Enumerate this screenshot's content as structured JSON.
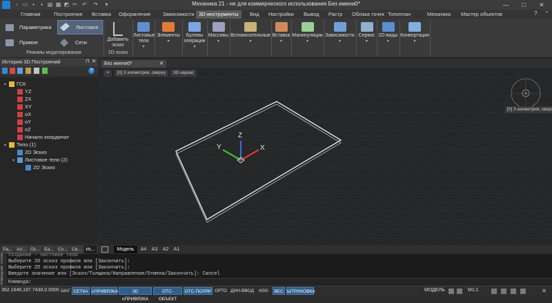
{
  "app": {
    "title": "Механика 21 - не для коммерческого использования Без имени0*"
  },
  "window_controls": {
    "minimize": "—",
    "maximize": "□",
    "close": "✕"
  },
  "menu": {
    "tabs": [
      "Главная",
      "Построение",
      "Вставка",
      "Оформление",
      "Зависимости",
      "3D-инструменты",
      "Вид",
      "Настройки",
      "Вывод",
      "Растр",
      "Облака точек",
      "Топоплан",
      "Механика",
      "Мастер объектов"
    ],
    "active": "3D-инструменты"
  },
  "ribbon": {
    "modes": {
      "param": "Параметрика",
      "direct": "Прямое",
      "sheet": "Листовое",
      "mesh": "Сети",
      "group_label": "Режимы моделирования"
    },
    "add_sketch": "Добавить эскиз",
    "sketch_group": "2D-эскиз",
    "buttons": [
      {
        "label": "Листовые тела",
        "id": "sheet-bodies"
      },
      {
        "label": "Элементы",
        "id": "elements"
      },
      {
        "label": "Булевы операции",
        "id": "boolean"
      },
      {
        "label": "Массивы",
        "id": "arrays"
      },
      {
        "label": "Вспомогательные",
        "id": "auxiliary"
      },
      {
        "label": "Вставка",
        "id": "insert"
      },
      {
        "label": "Манипуляции",
        "id": "manipulations"
      },
      {
        "label": "Зависимости",
        "id": "dependencies"
      },
      {
        "label": "Сервис",
        "id": "service"
      },
      {
        "label": "2D-виды",
        "id": "views2d"
      },
      {
        "label": "Конвертация",
        "id": "conversion"
      }
    ]
  },
  "left_panel": {
    "title": "История 3D Построений",
    "tree": [
      {
        "label": "ГСК",
        "level": 0,
        "icon": "folder",
        "twisty": "▾"
      },
      {
        "label": "YZ",
        "level": 1,
        "icon": "plane"
      },
      {
        "label": "ZX",
        "level": 1,
        "icon": "plane"
      },
      {
        "label": "XY",
        "level": 1,
        "icon": "plane"
      },
      {
        "label": "oX",
        "level": 1,
        "icon": "axis"
      },
      {
        "label": "oY",
        "level": 1,
        "icon": "axis"
      },
      {
        "label": "oZ",
        "level": 1,
        "icon": "axis"
      },
      {
        "label": "Начало координат",
        "level": 1,
        "icon": "origin"
      },
      {
        "label": "Тело (1)",
        "level": 0,
        "icon": "body",
        "twisty": "▾"
      },
      {
        "label": "2D Эскиз",
        "level": 1,
        "icon": "sketch"
      },
      {
        "label": "Листовое тело (2)",
        "level": 1,
        "icon": "sheet",
        "twisty": "▾"
      },
      {
        "label": "2D Эскиз",
        "level": 2,
        "icon": "sketch"
      }
    ],
    "tabs": [
      "Ра...",
      "Ал...",
      "Ос...",
      "Ба...",
      "Сп...",
      "Св...",
      "Ис..."
    ],
    "active_tab": "Ис..."
  },
  "document": {
    "tab": "Без имени0*",
    "view_buttons": [
      "+",
      "[0] 3 изометрия, сверху",
      "3D каркас"
    ],
    "viewcube_label": "[0] 3 изометрия, сверху",
    "axes": {
      "x": "X",
      "y": "Y",
      "z": "Z"
    },
    "layout_tabs": [
      "Модель",
      "A4",
      "A3",
      "A2",
      "A1"
    ],
    "active_layout": "Модель"
  },
  "command": {
    "side_label": "Командная строка",
    "history": [
      "Создание - листовое тело",
      "Выберите 2D эскиз профиля или [Закончить]:",
      "Выберите 2D эскиз профиля или [Закончить]:",
      "Введите значение или [Эскиз/Толщина/Направление/Отмена/Закончить]: Cancel"
    ],
    "prompt": "Команда:"
  },
  "status": {
    "coords": "362.1646,197.7438,0.0000",
    "toggles": [
      {
        "label": "ШАГ",
        "on": false
      },
      {
        "label": "СЕТКА",
        "on": true
      },
      {
        "label": "оПРИВЯЗКА",
        "on": true
      },
      {
        "label": "3D оПРИВЯЗКА",
        "on": true
      },
      {
        "label": "ОТС-ОБЪЕКТ",
        "on": true
      },
      {
        "label": "ОТС-ПОЛЯР",
        "on": true
      },
      {
        "label": "ОРТО",
        "on": false
      },
      {
        "label": "ДИН-ВВОД",
        "on": false
      },
      {
        "label": "ИЗО",
        "on": false
      },
      {
        "label": "ВЕС",
        "on": true
      },
      {
        "label": "ШТРИХОВКА",
        "on": true
      }
    ],
    "model": "МОДЕЛЬ",
    "scale": "M1:1"
  },
  "colors": {
    "accent": "#2f5e8a",
    "axis_x": "#d23c3c",
    "axis_y": "#3cbe3c",
    "axis_z": "#3c6bd2",
    "grid": "#323438"
  }
}
